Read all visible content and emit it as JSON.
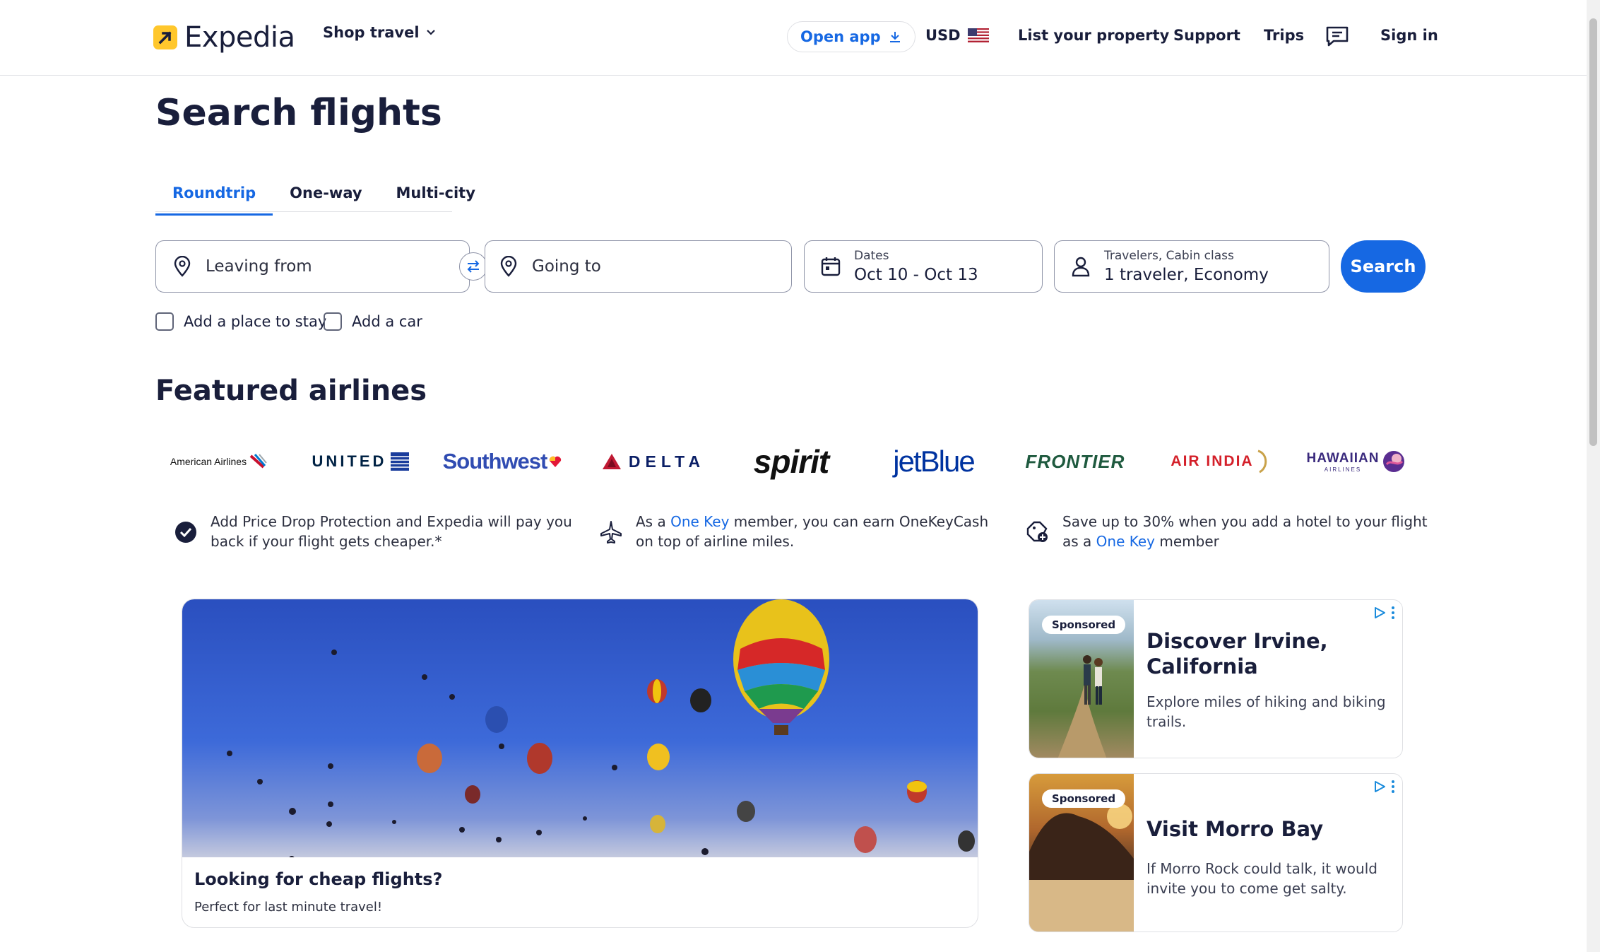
{
  "header": {
    "logo_text": "Expedia",
    "shop_travel": "Shop travel",
    "open_app": "Open app",
    "currency": "USD",
    "list_property": "List your property",
    "support": "Support",
    "trips": "Trips",
    "sign_in": "Sign in"
  },
  "page_title": "Search flights",
  "tabs": [
    {
      "label": "Roundtrip",
      "active": true
    },
    {
      "label": "One-way",
      "active": false
    },
    {
      "label": "Multi-city",
      "active": false
    }
  ],
  "search": {
    "leaving_placeholder": "Leaving from",
    "going_placeholder": "Going to",
    "dates_label": "Dates",
    "dates_value": "Oct 10 - Oct 13",
    "travelers_label": "Travelers, Cabin class",
    "travelers_value": "1 traveler, Economy",
    "search_button": "Search"
  },
  "options": {
    "add_stay": "Add a place to stay",
    "add_car": "Add a car"
  },
  "featured": {
    "title": "Featured airlines",
    "airlines": [
      "American Airlines",
      "UNITED",
      "Southwest",
      "DELTA",
      "spirit",
      "jetBlue",
      "FRONTIER",
      "AIR INDIA",
      "HAWAIIAN",
      "AIRLINES"
    ]
  },
  "benefits": {
    "b1_line1": "Add Price Drop Protection and Expedia will pay you",
    "b1_line2": "back if your flight gets cheaper.*",
    "b2_pre": "As a ",
    "b2_link": "One Key",
    "b2_post": " member, you can earn OneKeyCash",
    "b2_line2": "on top of airline miles.",
    "b3_line1": "Save up to 30% when you add a hotel to your flight",
    "b3_pre": "as a ",
    "b3_link": "One Key",
    "b3_post": " member"
  },
  "promo": {
    "title": "Looking for cheap flights?",
    "subtitle": "Perfect for last minute travel!"
  },
  "ads": [
    {
      "badge": "Sponsored",
      "title_line1": "Discover Irvine,",
      "title_line2": "California",
      "desc_line1": "Explore miles of hiking and biking",
      "desc_line2": "trails."
    },
    {
      "badge": "Sponsored",
      "title_line1": "Visit Morro Bay",
      "desc_line1": "If Morro Rock could talk, it would",
      "desc_line2": "invite you to come get salty."
    }
  ],
  "colors": {
    "brand_blue": "#1668e3",
    "text_dark": "#191e3b",
    "logo_yellow": "#ffc72c"
  }
}
